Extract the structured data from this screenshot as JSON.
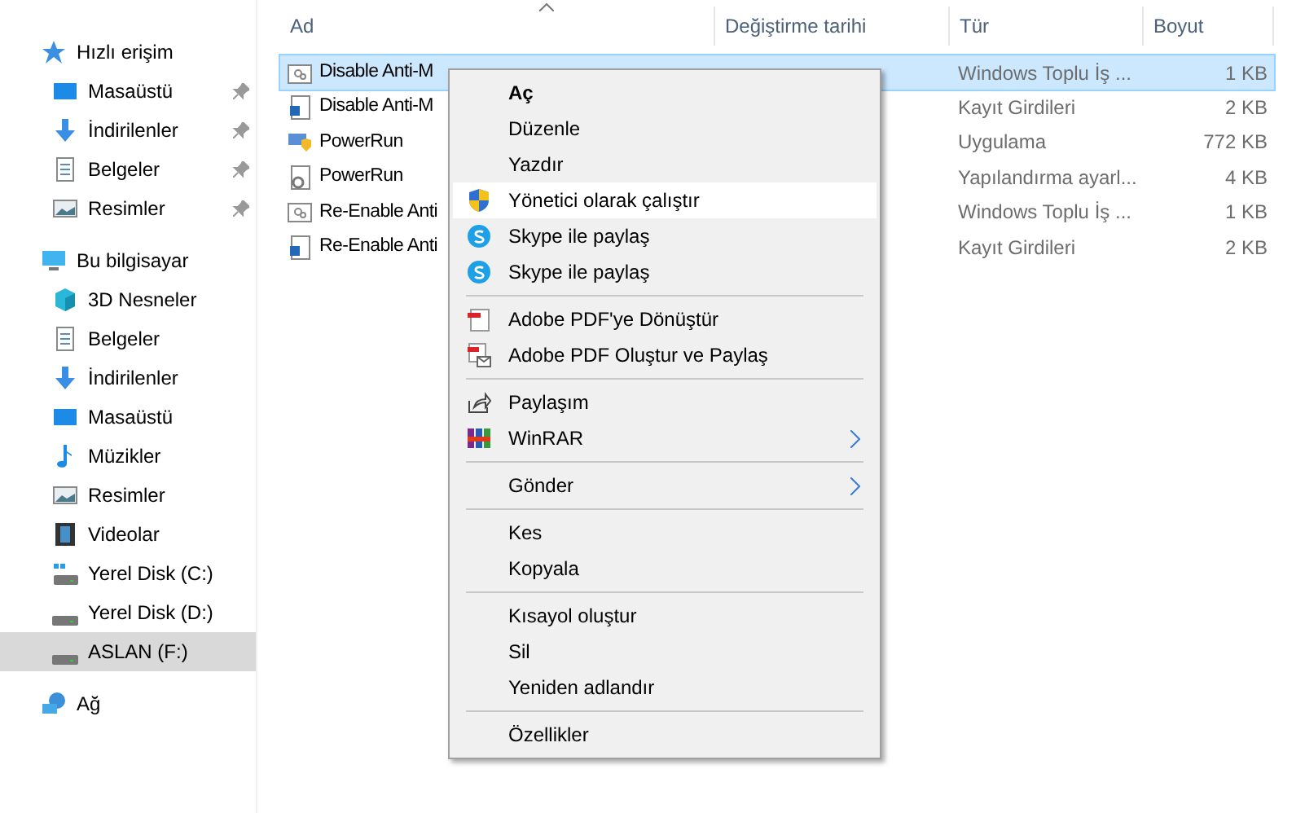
{
  "sidebar": {
    "groups": [
      {
        "label": "Hızlı erişim",
        "kind": "star",
        "selected": false,
        "children": [
          {
            "label": "Masaüstü",
            "kind": "desktop",
            "pinned": true,
            "selected": false
          },
          {
            "label": "İndirilenler",
            "kind": "download",
            "pinned": true,
            "selected": false
          },
          {
            "label": "Belgeler",
            "kind": "document",
            "pinned": true,
            "selected": false
          },
          {
            "label": "Resimler",
            "kind": "pictures",
            "pinned": true,
            "selected": false
          }
        ]
      },
      {
        "label": "Bu bilgisayar",
        "kind": "computer",
        "selected": false,
        "children": [
          {
            "label": "3D Nesneler",
            "kind": "cube",
            "selected": false
          },
          {
            "label": "Belgeler",
            "kind": "document",
            "selected": false
          },
          {
            "label": "İndirilenler",
            "kind": "download",
            "selected": false
          },
          {
            "label": "Masaüstü",
            "kind": "desktop",
            "selected": false
          },
          {
            "label": "Müzikler",
            "kind": "music",
            "selected": false
          },
          {
            "label": "Resimler",
            "kind": "pictures",
            "selected": false
          },
          {
            "label": "Videolar",
            "kind": "video",
            "selected": false
          },
          {
            "label": "Yerel Disk (C:)",
            "kind": "windisk",
            "selected": false
          },
          {
            "label": "Yerel Disk (D:)",
            "kind": "disk",
            "selected": false
          },
          {
            "label": "ASLAN (F:)",
            "kind": "disk",
            "selected": true
          }
        ]
      },
      {
        "label": "Ağ",
        "kind": "network",
        "selected": false
      }
    ]
  },
  "table": {
    "columns": [
      "Ad",
      "Değiştirme tarihi",
      "Tür",
      "Boyut"
    ],
    "rows": [
      {
        "name": "Disable Anti-M",
        "kind": "batch",
        "type": "Windows Toplu İş ...",
        "size": "1 KB",
        "selected": true
      },
      {
        "name": "Disable Anti-M",
        "kind": "registry",
        "type": "Kayıt Girdileri",
        "size": "2 KB",
        "selected": false
      },
      {
        "name": "PowerRun",
        "kind": "app",
        "type": "Uygulama",
        "size": "772 KB",
        "selected": false
      },
      {
        "name": "PowerRun",
        "kind": "config",
        "type": "Yapılandırma ayarl...",
        "size": "4 KB",
        "selected": false
      },
      {
        "name": "Re-Enable Anti",
        "kind": "batch",
        "type": "Windows Toplu İş ...",
        "size": "1 KB",
        "selected": false
      },
      {
        "name": "Re-Enable Anti",
        "kind": "registry",
        "type": "Kayıt Girdileri",
        "size": "2 KB",
        "selected": false
      }
    ]
  },
  "context_menu": {
    "sections": [
      [
        {
          "label": "Aç",
          "bold": true,
          "selected": false
        },
        {
          "label": "Düzenle",
          "selected": false
        },
        {
          "label": "Yazdır",
          "selected": false
        },
        {
          "label": "Yönetici olarak çalıştır",
          "kind": "shield",
          "selected": true
        },
        {
          "label": "Skype ile paylaş",
          "kind": "skype",
          "selected": false
        },
        {
          "label": "Skype ile paylaş",
          "kind": "skype",
          "selected": false
        }
      ],
      [
        {
          "label": "Adobe PDF'ye Dönüştür",
          "kind": "pdf",
          "selected": false
        },
        {
          "label": "Adobe PDF Oluştur ve Paylaş",
          "kind": "pdfmail",
          "selected": false
        }
      ],
      [
        {
          "label": "Paylaşım",
          "kind": "share",
          "selected": false
        },
        {
          "label": "WinRAR",
          "kind": "winrar",
          "submenu": true,
          "selected": false
        }
      ],
      [
        {
          "label": "Gönder",
          "submenu": true,
          "selected": false
        }
      ],
      [
        {
          "label": "Kes",
          "selected": false
        },
        {
          "label": "Kopyala",
          "selected": false
        }
      ],
      [
        {
          "label": "Kısayol oluştur",
          "selected": false
        },
        {
          "label": "Sil",
          "selected": false
        },
        {
          "label": "Yeniden adlandır",
          "selected": false
        }
      ],
      [
        {
          "label": "Özellikler",
          "selected": false
        }
      ]
    ]
  }
}
